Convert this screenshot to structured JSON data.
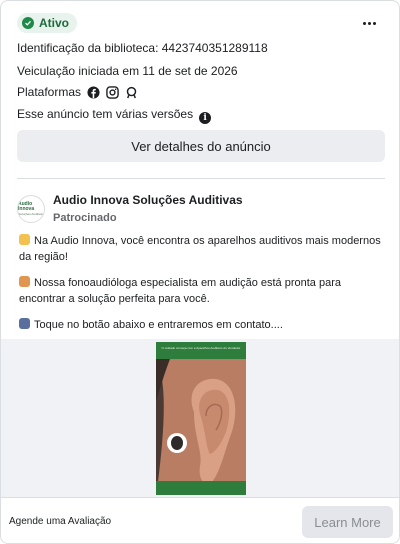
{
  "status": {
    "label": "Ativo",
    "color": "#1d8a4a"
  },
  "menu_icon": "more-horizontal-icon",
  "library_id_line": "Identificação da biblioteca: 4423740351289118",
  "started_line": "Veiculação iniciada em 11 de set de 2026",
  "platforms": {
    "label": "Plataformas",
    "icons": [
      "facebook-icon",
      "instagram-icon",
      "audience-network-icon"
    ]
  },
  "versions_line": "Esse anúncio tem várias versões",
  "details_button_label": "Ver detalhes do anúncio",
  "advertiser": {
    "name": "Audio Innova Soluções Auditivas",
    "sponsored": "Patrocinado",
    "avatar_text": "Audio Innova",
    "avatar_subtext": "Soluções Auditivas"
  },
  "ad_body": {
    "p1": "Na Audio Innova, você encontra os aparelhos auditivos mais modernos da região!",
    "p2": "Nossa fonoaudióloga especialista em audição está pronta para encontrar a solução perfeita para você.",
    "p3": "Toque no botão abaixo e entraremos em contato...."
  },
  "creative": {
    "headline": "O cuidado começa com a Aparelhos Auditivos do Vendedor"
  },
  "footer": {
    "caption": "Agende uma Avaliação",
    "cta_label": "Learn More"
  }
}
